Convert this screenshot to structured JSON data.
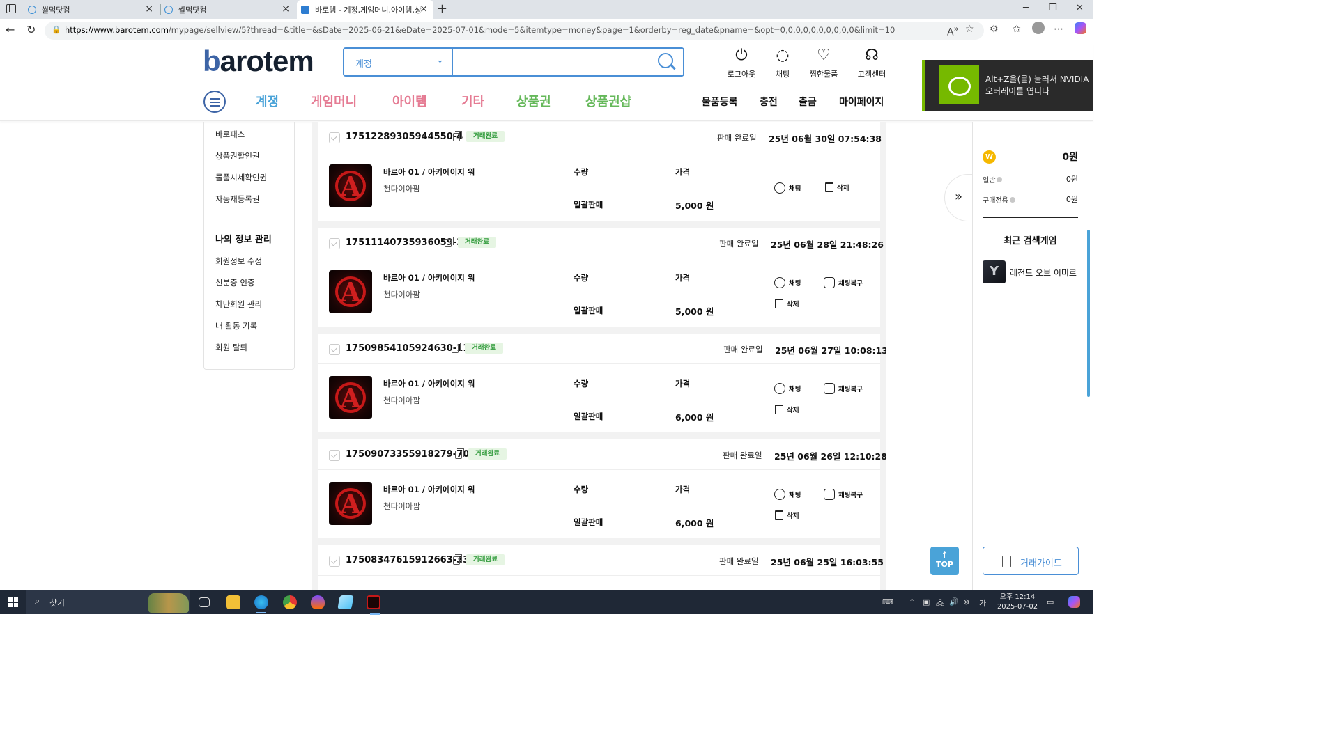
{
  "browser": {
    "tabs": [
      {
        "title": "쌀먹닷컴"
      },
      {
        "title": "쌀먹닷컴"
      },
      {
        "title": "바로템 - 계정,게임머니,아이템,상"
      }
    ],
    "url_host": "https://www.barotem.com",
    "url_path": "/mypage/sellview/5?thread=&title=&sDate=2025-06-21&eDate=2025-07-01&mode=5&itemtype=money&page=1&orderby=reg_date&pname=&opt=0,0,0,0,0,0,0,0,0,0&limit=10"
  },
  "header": {
    "logo_b": "b",
    "logo_rest": "arotem",
    "search": {
      "category": "계정",
      "placeholder": ""
    },
    "icons": [
      {
        "label": "로그아웃",
        "glyph": "⏻",
        "icon": "power-icon"
      },
      {
        "label": "채팅",
        "glyph": "💬",
        "icon": "chat-icon"
      },
      {
        "label": "찜한물품",
        "glyph": "♡",
        "icon": "heart-icon"
      },
      {
        "label": "고객센터",
        "glyph": "🎧",
        "icon": "headset-icon"
      }
    ],
    "categories": [
      {
        "label": "계정",
        "color": "#4aa3d8"
      },
      {
        "label": "게임머니",
        "color": "#e57b93"
      },
      {
        "label": "아이템",
        "color": "#e57b93"
      },
      {
        "label": "기타",
        "color": "#e57b93"
      },
      {
        "label": "상품권",
        "color": "#65b85a"
      },
      {
        "label": "상품권샵",
        "color": "#65b85a"
      }
    ],
    "right_links": [
      "물품등록",
      "충전",
      "출금",
      "마이페이지"
    ]
  },
  "nvidia": {
    "line1": "Alt+Z을(를) 눌러서 NVIDIA",
    "line2": "오버레이를 엽니다"
  },
  "left_menu": {
    "top_items": [
      "바로패스",
      "상품권할인권",
      "물품시세확인권",
      "자동재등록권"
    ],
    "section_title": "나의 정보 관리",
    "section_items": [
      "회원정보 수정",
      "신분증 인증",
      "차단회원 관리",
      "내 활동 기록",
      "회원 탈퇴"
    ]
  },
  "orders": [
    {
      "id": "17512289305944550-4",
      "status": "거래완료",
      "done_label": "판매 완료일",
      "done_date": "25년 06월 30일 07:54:38",
      "title": "바르아 01 / 아키에이지 워",
      "subtitle": "천다이아팜",
      "qty_label": "수량",
      "qty": "일괄판매",
      "price_label": "가격",
      "price": "5,000 원",
      "actions": [
        "채팅",
        "삭제"
      ]
    },
    {
      "id": "17511140735936059-3",
      "status": "거래완료",
      "done_label": "판매 완료일",
      "done_date": "25년 06월 28일 21:48:26",
      "title": "바르아 01 / 아키에이지 워",
      "subtitle": "천다이아팜",
      "qty_label": "수량",
      "qty": "일괄판매",
      "price_label": "가격",
      "price": "5,000 원",
      "actions": [
        "채팅",
        "채팅복구",
        "삭제"
      ]
    },
    {
      "id": "17509854105924630-11",
      "status": "거래완료",
      "done_label": "판매 완료일",
      "done_date": "25년 06월 27일 10:08:13",
      "title": "바르아 01 / 아키에이지 워",
      "subtitle": "천다이아팜",
      "qty_label": "수량",
      "qty": "일괄판매",
      "price_label": "가격",
      "price": "6,000 원",
      "actions": [
        "채팅",
        "채팅복구",
        "삭제"
      ]
    },
    {
      "id": "17509073355918279-70",
      "status": "거래완료",
      "done_label": "판매 완료일",
      "done_date": "25년 06월 26일 12:10:28",
      "title": "바르아 01 / 아키에이지 워",
      "subtitle": "천다이아팜",
      "qty_label": "수량",
      "qty": "일괄판매",
      "price_label": "가격",
      "price": "6,000 원",
      "actions": [
        "채팅",
        "채팅복구",
        "삭제"
      ]
    },
    {
      "id": "17508347615912663-33",
      "status": "거래완료",
      "done_label": "판매 완료일",
      "done_date": "25년 06월 25일 16:03:55"
    }
  ],
  "right_panel": {
    "coin_glyph": "W",
    "total": "0원",
    "rows": [
      {
        "label": "일반",
        "value": "0원"
      },
      {
        "label": "구매전용",
        "value": "0원"
      }
    ],
    "recent_title": "최근 검색게임",
    "recent_game": "레전드 오브 이미르",
    "guide_label": "거래가이드"
  },
  "top_button": {
    "arrow": "↑",
    "label": "TOP"
  },
  "taskbar": {
    "search_placeholder": "찾기",
    "clock_time": "오후 12:14",
    "clock_date": "2025-07-02"
  }
}
